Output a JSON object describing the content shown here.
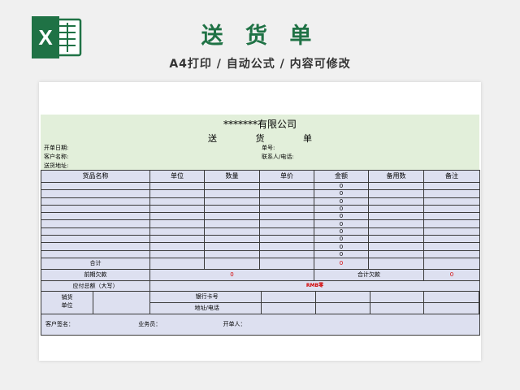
{
  "header": {
    "title": "送 货 单",
    "subtitle": "A4打印 / 自动公式 / 内容可修改",
    "icon": "excel-icon",
    "accent": "#1f7245"
  },
  "sheet": {
    "company": "*******有限公司",
    "doc_title": "送 货 单",
    "fields": {
      "date": "开单日期:",
      "number": "单号:",
      "customer": "客户名称:",
      "contact": "联系人/电话:",
      "address": "送货地址:"
    },
    "columns": [
      "货品名称",
      "单位",
      "数量",
      "单价",
      "金额",
      "备用数",
      "备注"
    ],
    "item_amounts": [
      "0",
      "0",
      "0",
      "0",
      "0",
      "0",
      "0",
      "0",
      "0",
      "0"
    ],
    "summary": {
      "total_label": "合计",
      "total_value": "0",
      "prev_debt_label": "前期欠款",
      "prev_debt_value": "0",
      "total_debt_label": "合计欠款",
      "total_debt_value": "0",
      "payable_label": "应付总额（大写）",
      "payable_value": "RMB零"
    },
    "seller": {
      "label": "销货单位",
      "bank": "银行卡号",
      "address": "地址/电话"
    },
    "signatures": {
      "customer": "客户签名：",
      "salesman": "业务员：",
      "issuer": "开单人："
    },
    "colors": {
      "header_bg": "#e2efda",
      "table_bg": "#dde0f0",
      "alert": "#d40000"
    }
  }
}
